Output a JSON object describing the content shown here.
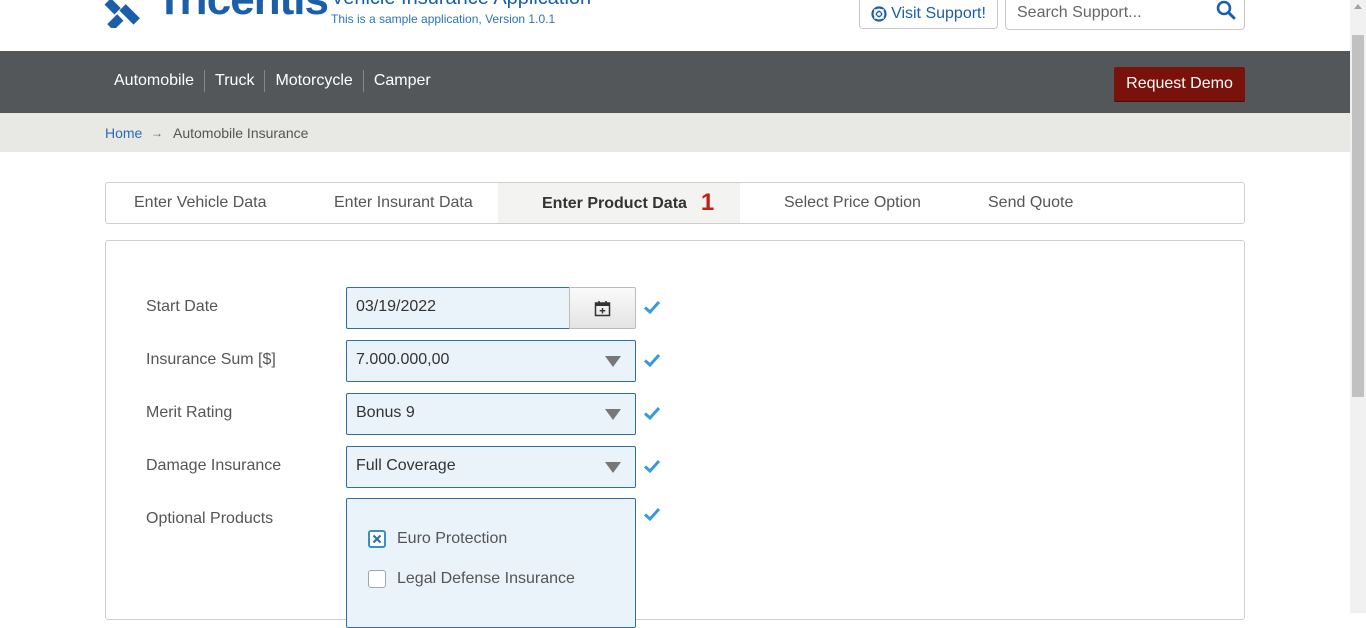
{
  "header": {
    "logo_text": "Tricentis",
    "app_title": "Vehicle Insurance Application",
    "app_subtitle": "This is a sample application, Version 1.0.1",
    "support_label": "Visit Support!",
    "search_placeholder": "Search Support..."
  },
  "nav": {
    "items": [
      {
        "label": "Automobile"
      },
      {
        "label": "Truck"
      },
      {
        "label": "Motorcycle"
      },
      {
        "label": "Camper"
      }
    ],
    "demo_label": "Request Demo"
  },
  "breadcrumb": {
    "home": "Home",
    "arrow": "→",
    "current": "Automobile Insurance"
  },
  "tabs": [
    {
      "label": "Enter Vehicle Data"
    },
    {
      "label": "Enter Insurant Data"
    },
    {
      "label": "Enter Product Data",
      "badge": "1",
      "active": true
    },
    {
      "label": "Select Price Option"
    },
    {
      "label": "Send Quote"
    }
  ],
  "form": {
    "start_date": {
      "label": "Start Date",
      "value": "03/19/2022"
    },
    "insurance_sum": {
      "label": "Insurance Sum [$]",
      "value": "7.000.000,00"
    },
    "merit_rating": {
      "label": "Merit Rating",
      "value": "Bonus 9"
    },
    "damage_insurance": {
      "label": "Damage Insurance",
      "value": "Full Coverage"
    },
    "optional_products": {
      "label": "Optional Products",
      "options": [
        {
          "label": "Euro Protection",
          "checked": true
        },
        {
          "label": "Legal Defense Insurance",
          "checked": false
        }
      ]
    }
  },
  "colors": {
    "brand_blue": "#1b5fa8",
    "navbar": "#54575a",
    "demo_button": "#7a120c",
    "badge_red": "#c0221a",
    "field_bg": "#eaf2fa",
    "valid_check": "#3a9ad9"
  },
  "icons": {
    "support": "lifebuoy-icon",
    "search": "search-icon",
    "calendar": "calendar-icon",
    "valid": "check-icon"
  }
}
